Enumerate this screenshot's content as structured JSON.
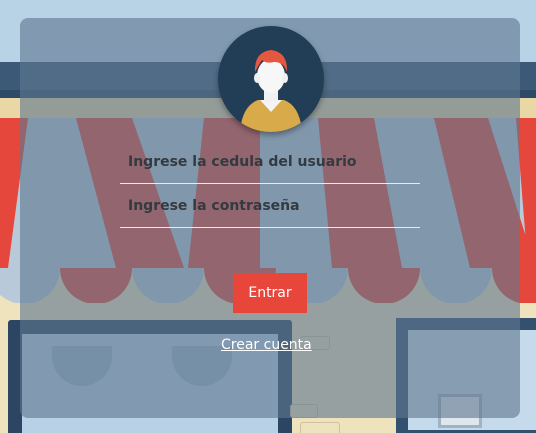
{
  "login_form": {
    "id_field": {
      "value": "",
      "placeholder": "Ingrese la cedula del usuario"
    },
    "password_field": {
      "value": "",
      "placeholder": "Ingrese la contraseña"
    },
    "submit_label": "Entrar",
    "register_link_label": "Crear cuenta"
  },
  "icons": {
    "avatar": "user-avatar-icon"
  },
  "colors": {
    "accent": "#e8463b",
    "panel_overlay": "#607890",
    "avatar_background": "#223d56",
    "awning_red": "#e5473c",
    "awning_light": "#b8cad9"
  }
}
